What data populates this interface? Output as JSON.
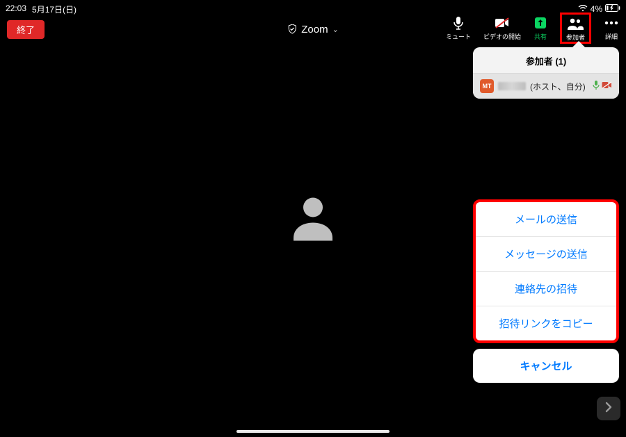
{
  "status": {
    "time": "22:03",
    "date": "5月17日(日)",
    "battery": "4%"
  },
  "toolbar": {
    "end_label": "終了",
    "title": "Zoom",
    "mute_label": "ミュート",
    "video_label": "ビデオの開始",
    "share_label": "共有",
    "participants_label": "参加者",
    "more_label": "詳細"
  },
  "panel": {
    "title": "参加者 (1)",
    "participant": {
      "avatar_initials": "MT",
      "suffix": "(ホスト、自分)"
    }
  },
  "invite": {
    "options": [
      "メールの送信",
      "メッセージの送信",
      "連絡先の招待",
      "招待リンクをコピー"
    ],
    "cancel": "キャンセル"
  }
}
